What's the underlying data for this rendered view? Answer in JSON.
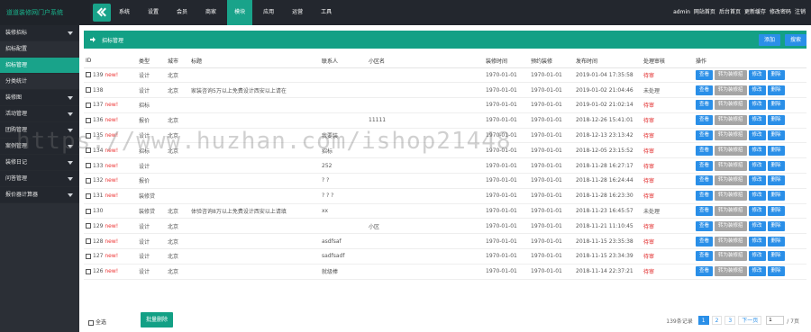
{
  "brand": "道道装修网门户系统",
  "nav": [
    "系统",
    "设置",
    "会员",
    "商家",
    "模块",
    "应用",
    "运营",
    "工具"
  ],
  "nav_active_index": 4,
  "user_links": [
    "admin",
    "网站首页",
    "后台首页",
    "更新缓存",
    "修改密码",
    "注销"
  ],
  "sidebar": [
    {
      "label": "装修招标",
      "type": "group",
      "arrow": true
    },
    {
      "label": "招标配置",
      "type": "item"
    },
    {
      "label": "招标管理",
      "type": "item",
      "active": true
    },
    {
      "label": "分类统计",
      "type": "item"
    },
    {
      "label": "装修图",
      "type": "group",
      "arrow": true
    },
    {
      "label": "活动管理",
      "type": "group",
      "arrow": true
    },
    {
      "label": "团购管理",
      "type": "group",
      "arrow": true
    },
    {
      "label": "案例管理",
      "type": "group",
      "arrow": true
    },
    {
      "label": "装修日记",
      "type": "group",
      "arrow": true
    },
    {
      "label": "问答管理",
      "type": "group",
      "arrow": true
    },
    {
      "label": "报价器计算器",
      "type": "group",
      "arrow": true
    }
  ],
  "panel": {
    "title": "招标管理",
    "add_label": "添加",
    "search_label": "搜索"
  },
  "columns": [
    "ID",
    "类型",
    "城市",
    "标题",
    "联系人",
    "小区名",
    "装修时间",
    "预约装修",
    "发布时间",
    "处理审核",
    "操作"
  ],
  "rows": [
    {
      "id": "139",
      "new": "new!",
      "type": "设计",
      "city": "北京",
      "title": "",
      "contact": "",
      "community": "",
      "t1": "1970-01-01",
      "t2": "1970-01-01",
      "pub": "2019-01-04 17:35:58",
      "status": "待审",
      "status_red": true,
      "convert": false
    },
    {
      "id": "138",
      "new": "",
      "type": "设计",
      "city": "北京",
      "title": "家装咨询5万以上免费设计西安以上请在",
      "contact": "",
      "community": "",
      "t1": "1970-01-01",
      "t2": "1970-01-01",
      "pub": "2019-01-02 21:04:46",
      "status": "未处理",
      "status_red": false,
      "convert": true
    },
    {
      "id": "137",
      "new": "new!",
      "type": "招标",
      "city": "",
      "title": "",
      "contact": "",
      "community": "",
      "t1": "1970-01-01",
      "t2": "1970-01-01",
      "pub": "2019-01-02 21:02:14",
      "status": "待审",
      "status_red": true,
      "convert": true
    },
    {
      "id": "136",
      "new": "new!",
      "type": "报价",
      "city": "北京",
      "title": "",
      "contact": "",
      "community": "11111",
      "t1": "1970-01-01",
      "t2": "1970-01-01",
      "pub": "2018-12-26 15:41:01",
      "status": "待审",
      "status_red": true,
      "convert": true
    },
    {
      "id": "135",
      "new": "new!",
      "type": "设计",
      "city": "北京",
      "title": "",
      "contact": "我要装",
      "community": "",
      "t1": "1970-01-01",
      "t2": "1970-01-01",
      "pub": "2018-12-13 23:13:42",
      "status": "待审",
      "status_red": true,
      "convert": true
    },
    {
      "id": "134",
      "new": "new!",
      "type": "招标",
      "city": "北京",
      "title": "",
      "contact": "招标",
      "community": "",
      "t1": "1970-01-01",
      "t2": "1970-01-01",
      "pub": "2018-12-05 23:15:52",
      "status": "待审",
      "status_red": true,
      "convert": true
    },
    {
      "id": "133",
      "new": "new!",
      "type": "设计",
      "city": "",
      "title": "",
      "contact": "252",
      "community": "",
      "t1": "1970-01-01",
      "t2": "1970-01-01",
      "pub": "2018-11-28 16:27:17",
      "status": "待审",
      "status_red": true,
      "convert": true
    },
    {
      "id": "132",
      "new": "new!",
      "type": "报价",
      "city": "",
      "title": "",
      "contact": "? ?",
      "community": "",
      "t1": "1970-01-01",
      "t2": "1970-01-01",
      "pub": "2018-11-28 16:24:44",
      "status": "待审",
      "status_red": true,
      "convert": true
    },
    {
      "id": "131",
      "new": "new!",
      "type": "装修贷",
      "city": "",
      "title": "",
      "contact": "? ? ?",
      "community": "",
      "t1": "1970-01-01",
      "t2": "1970-01-01",
      "pub": "2018-11-28 16:23:30",
      "status": "待审",
      "status_red": true,
      "convert": true
    },
    {
      "id": "130",
      "new": "",
      "type": "装修贷",
      "city": "北京",
      "title": "体验咨询8万以上免费设计西安以上请填",
      "contact": "xx",
      "community": "",
      "t1": "1970-01-01",
      "t2": "1970-01-01",
      "pub": "2018-11-23 16:45:57",
      "status": "未处理",
      "status_red": false,
      "convert": true
    },
    {
      "id": "129",
      "new": "new!",
      "type": "设计",
      "city": "北京",
      "title": "",
      "contact": "",
      "community": "小区",
      "t1": "1970-01-01",
      "t2": "1970-01-01",
      "pub": "2018-11-21 11:10:45",
      "status": "待审",
      "status_red": true,
      "convert": true
    },
    {
      "id": "128",
      "new": "new!",
      "type": "设计",
      "city": "北京",
      "title": "",
      "contact": "asdfsaf",
      "community": "",
      "t1": "1970-01-01",
      "t2": "1970-01-01",
      "pub": "2018-11-15 23:35:38",
      "status": "待审",
      "status_red": true,
      "convert": true
    },
    {
      "id": "127",
      "new": "new!",
      "type": "设计",
      "city": "北京",
      "title": "",
      "contact": "sadfsadf",
      "community": "",
      "t1": "1970-01-01",
      "t2": "1970-01-01",
      "pub": "2018-11-15 23:34:39",
      "status": "待审",
      "status_red": true,
      "convert": true
    },
    {
      "id": "126",
      "new": "new!",
      "type": "设计",
      "city": "北京",
      "title": "",
      "contact": "就级棒",
      "community": "",
      "t1": "1970-01-01",
      "t2": "1970-01-01",
      "pub": "2018-11-14 22:37:21",
      "status": "待审",
      "status_red": true,
      "convert": true
    }
  ],
  "actions": {
    "view": "查看",
    "convert": "转为装修招",
    "edit": "修改",
    "delete": "删除"
  },
  "footer": {
    "select_all": "全选",
    "batch_delete": "批量删除",
    "record_count": "139条记录",
    "pages": [
      "1",
      "2",
      "3"
    ],
    "next": "下一页",
    "page_input": "1",
    "total_pages": "/ 7页"
  },
  "watermark": "https://www.huzhan.com/ishop21448"
}
